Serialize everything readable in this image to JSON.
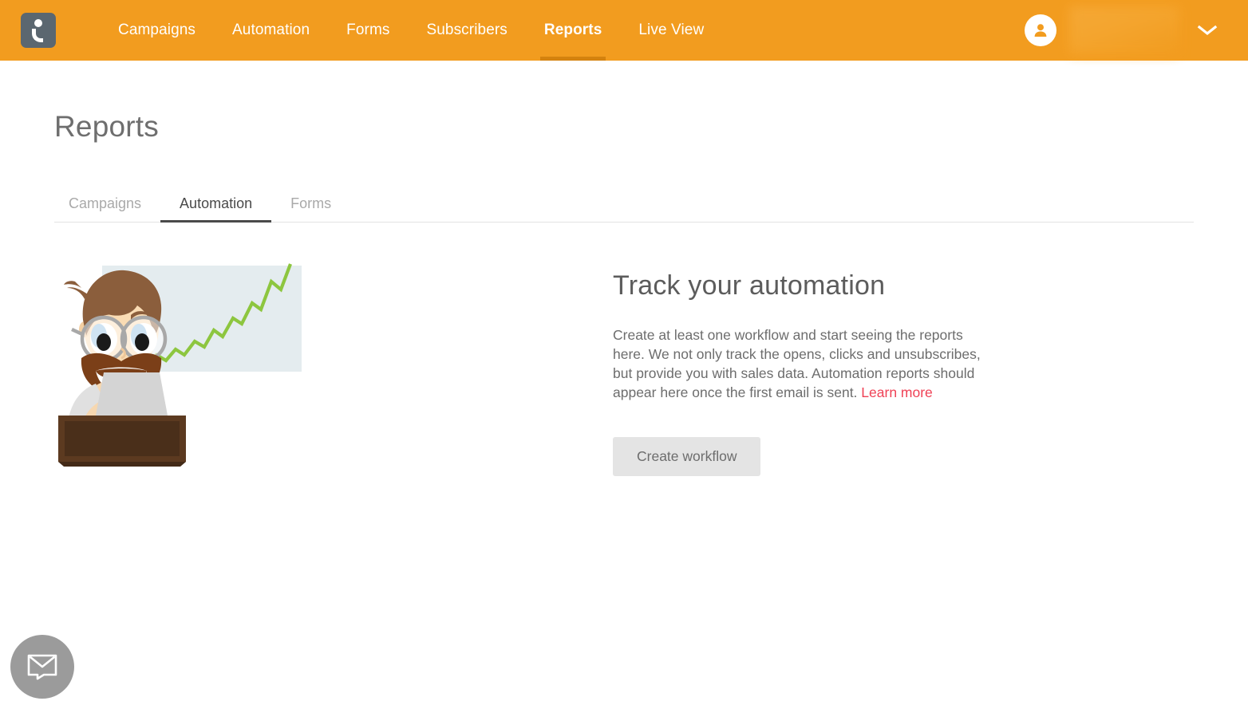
{
  "header": {
    "logo_name": "getresponse-logo",
    "nav": [
      {
        "label": "Campaigns",
        "active": false
      },
      {
        "label": "Automation",
        "active": false
      },
      {
        "label": "Forms",
        "active": false
      },
      {
        "label": "Subscribers",
        "active": false
      },
      {
        "label": "Reports",
        "active": true
      },
      {
        "label": "Live View",
        "active": false
      }
    ],
    "account": {
      "avatar_icon": "user-avatar-icon",
      "username": "",
      "username_redacted": true,
      "dropdown_icon": "chevron-down-icon"
    },
    "background_color": "#f29c1f",
    "active_underline_color": "#d4820f"
  },
  "page": {
    "title": "Reports"
  },
  "tabs": [
    {
      "label": "Campaigns",
      "active": false
    },
    {
      "label": "Automation",
      "active": true
    },
    {
      "label": "Forms",
      "active": false
    }
  ],
  "empty_state": {
    "illustration_name": "man-at-laptop-with-growth-chart-illustration",
    "title": "Track your automation",
    "body_text": "Create at least one workflow and start seeing the reports here. We not only track the opens, clicks and unsubscribes, but provide you with sales data. Automation reports should appear here once the first email is sent.",
    "learn_more_label": "Learn more",
    "learn_more_color": "#ef4155",
    "button_label": "Create workflow"
  },
  "chat_widget": {
    "icon": "envelope-chat-icon",
    "color": "#9b9b9b"
  }
}
